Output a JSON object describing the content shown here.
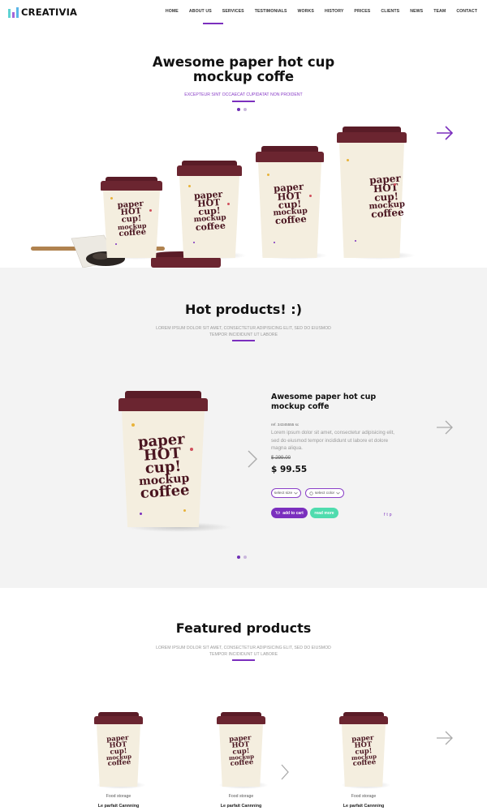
{
  "header": {
    "brand": "CREATIVIA",
    "nav": [
      "HOME",
      "ABOUT US",
      "SERVICES",
      "TESTIMONIALS",
      "WORKS",
      "HISTORY",
      "PRICES",
      "CLIENTS",
      "NEWS",
      "TEAM",
      "CONTACT"
    ],
    "active_nav": "HOME",
    "accent_color": "#7b2fbe"
  },
  "hero": {
    "title_line1": "Awesome paper hot cup",
    "title_line2": "mockup coffe",
    "subtitle": "EXCEPTEUR SINT OCCAECAT CUPIDATAT NON PROIDENT",
    "next_icon": "arrow-right-icon",
    "slides": 2,
    "active_slide": 1
  },
  "cup_print": {
    "line1": "paper",
    "line2": "HOT",
    "line3": "cup!",
    "line4": "mockup",
    "line5": "coffee"
  },
  "hot_products": {
    "title": "Hot products! :)",
    "subtitle": "LOREM IPSUM DOLOR SIT AMET, CONSECTETUR ADIPISICING ELIT, SED DO EIUSMOD TEMPOR INCIDIDUNT UT LABORE",
    "product": {
      "title": "Awesome paper hot cup mockup coffe",
      "ref": "ref. 34345555 sc",
      "description": "Lorem ipsum dolor sit amet, consectetur adipisicing elit, sed do eiusmod tempor incididunt ut labore et dolore magna aliqua.",
      "old_price": "$ 299.00",
      "price": "$ 99.55",
      "select_size": "select size",
      "select_color": "select color",
      "add_to_cart": "add to cart",
      "read_more": "read more",
      "social": [
        "f",
        "t",
        "p"
      ]
    },
    "slides": 2,
    "active_slide": 1
  },
  "featured": {
    "title": "Featured products",
    "subtitle": "LOREM IPSUM DOLOR SIT AMET, CONSECTETUR ADIPISICING ELIT, SED DO EIUSMOD TEMPOR INCIDIDUNT UT LABORE",
    "items": [
      {
        "category": "Food storage",
        "name": "Le parfait Cannning"
      },
      {
        "category": "Food storage",
        "name": "Le parfait Cannning"
      },
      {
        "category": "Food storage",
        "name": "Le parfait Cannning"
      }
    ]
  }
}
